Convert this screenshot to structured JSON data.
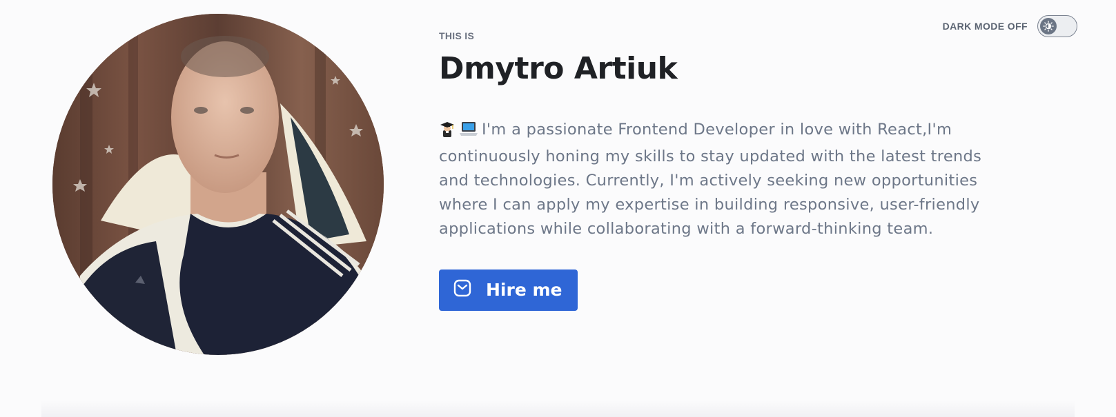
{
  "theme_toggle": {
    "label": "DARK MODE OFF",
    "state": "off",
    "icon": "sun-icon"
  },
  "hero": {
    "eyebrow": "THIS IS",
    "name": "Dmytro Artiuk",
    "bio_emojis": [
      "graduate-emoji",
      "laptop-emoji"
    ],
    "bio": "I'm a passionate Frontend Developer in love with React,I'm continuously honing my skills to stay updated with the latest trends and technologies. Currently, I'm actively seeking new opportunities where I can apply my expertise in building responsive, user-friendly applications while collaborating with a forward-thinking team.",
    "cta_label": "Hire me",
    "cta_icon": "mail-icon"
  },
  "colors": {
    "accent": "#2f66d6",
    "background": "#fbfbfc",
    "text_muted": "#6d7788",
    "heading": "#1f2125"
  }
}
